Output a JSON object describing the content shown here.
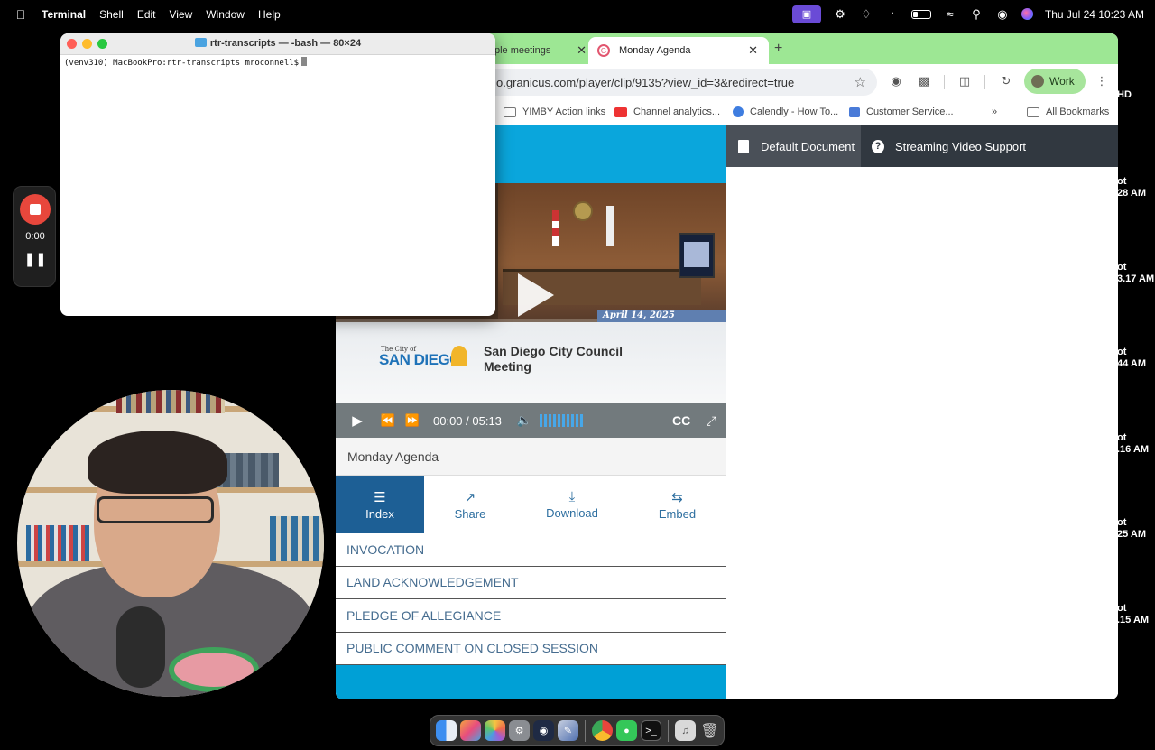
{
  "menubar": {
    "apple_icon": "apple-logo",
    "app_name": "Terminal",
    "menus": [
      "Shell",
      "Edit",
      "View",
      "Window",
      "Help"
    ],
    "clock": "Thu Jul 24  10:23 AM"
  },
  "terminal": {
    "title": "rtr-transcripts — -bash — 80×24",
    "prompt": "(venv310) MacBookPro:rtr-transcripts mroconnell$"
  },
  "recorder": {
    "time": "0:00"
  },
  "browser": {
    "tabs": [
      {
        "label": "ple meetings",
        "active": false
      },
      {
        "label": "Monday Agenda",
        "active": true
      }
    ],
    "url": "o.granicus.com/player/clip/9135?view_id=3&redirect=true",
    "profile_label": "Work",
    "bookmarks": [
      "YIMBY Action links",
      "Channel analytics...",
      "Calendly - How To...",
      "Customer Service...",
      "All Bookmarks"
    ]
  },
  "player": {
    "date_overlay": "April 14, 2025",
    "city_small": "The City of",
    "city_logo": "SAN DIEGO",
    "meeting_title": "San Diego City Council Meeting",
    "time_display": "00:00 / 05:13",
    "cc_label": "CC",
    "agenda_title": "Monday Agenda",
    "actions": [
      {
        "label": "Index",
        "icon": "list-icon",
        "active": true
      },
      {
        "label": "Share",
        "icon": "share-icon",
        "active": false
      },
      {
        "label": "Download",
        "icon": "download-icon",
        "active": false
      },
      {
        "label": "Embed",
        "icon": "embed-icon",
        "active": false
      }
    ],
    "index_items": [
      "INVOCATION",
      "LAND ACKNOWLEDGEMENT",
      "PLEDGE OF ALLEGIANCE",
      "PUBLIC COMMENT ON CLOSED SESSION"
    ]
  },
  "documents": {
    "tabs": [
      "Default Document",
      "Streaming Video Support"
    ]
  },
  "background_fragments": [
    "HD",
    "ot",
    "28 AM",
    "ot",
    "3.17 AM",
    "ot",
    "44 AM",
    "ot",
    ".16 AM",
    "ot",
    "25 AM",
    "ot",
    ".15 AM"
  ],
  "colors": {
    "tabbar": "#9de794",
    "page_blue": "#00a0d6",
    "action_active": "#1d5f95",
    "doc_tabbar": "#313840"
  }
}
